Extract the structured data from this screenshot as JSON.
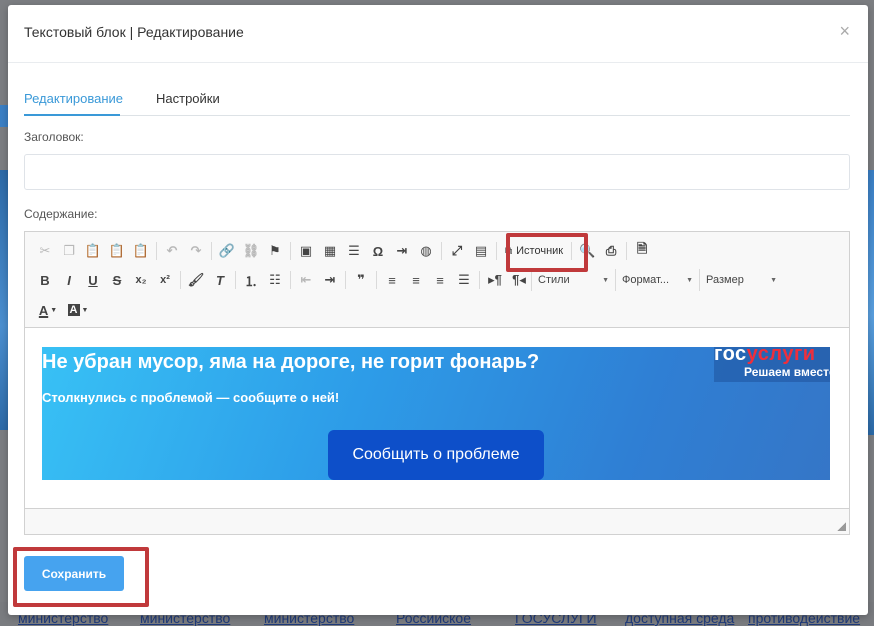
{
  "modal": {
    "title": "Текстовый блок | Редактирование",
    "close_glyph": "×"
  },
  "tabs": [
    {
      "label": "Редактирование",
      "active": true
    },
    {
      "label": "Настройки",
      "active": false
    }
  ],
  "form": {
    "title_label": "Заголовок:",
    "title_value": "",
    "content_label": "Содержание:"
  },
  "toolbar": {
    "source_label": "Источник",
    "combos": {
      "styles": "Стили",
      "format": "Формат...",
      "size": "Размер"
    }
  },
  "banner": {
    "heading": "Не убран мусор, яма на дороге, не горит фонарь?",
    "subheading": "Столкнулись с проблемой — сообщите о ней!",
    "button_label": "Сообщить о проблеме",
    "logo_white": "гос",
    "logo_red": "услуги",
    "logo_tagline": "Решаем вместе"
  },
  "actions": {
    "save_label": "Сохранить"
  },
  "background_footer": [
    "министерство",
    "министерство",
    "министерство",
    "Российское",
    "ГОСУСЛУГИ",
    "доступная среда",
    "противодействие"
  ],
  "colors": {
    "accent": "#3a99d8",
    "save_button": "#46a3ef",
    "banner_button": "#0d4fc9",
    "highlight": "#c0393b"
  }
}
